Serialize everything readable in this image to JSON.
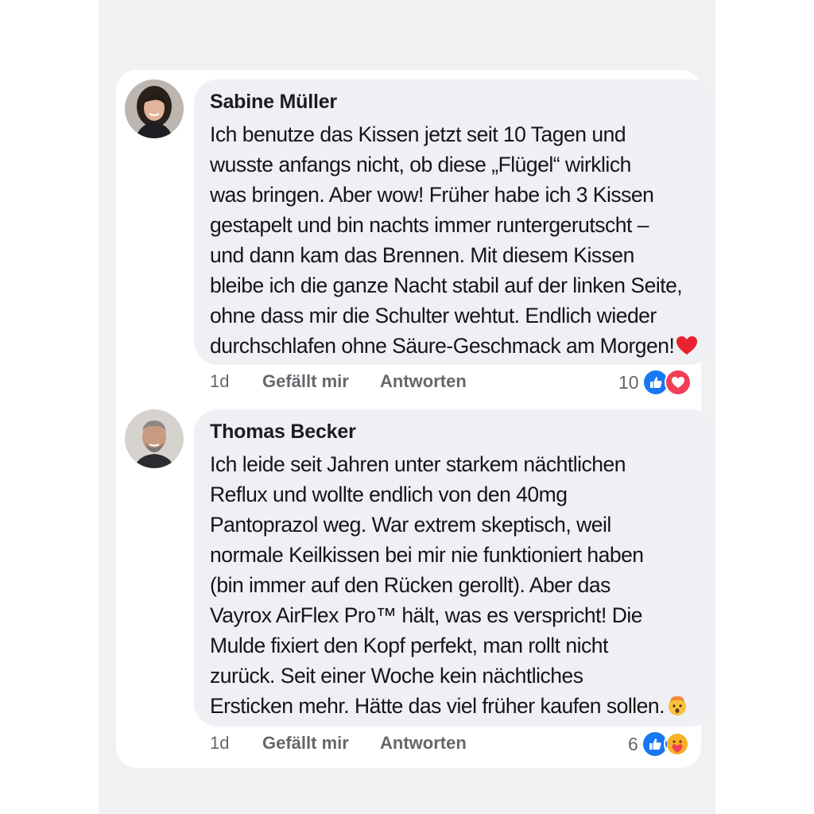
{
  "comments": [
    {
      "author": "Sabine Müller",
      "lines": [
        "Ich benutze das Kissen jetzt seit 10 Tagen und",
        "wusste anfangs nicht, ob diese „Flügel“ wirklich",
        "was bringen. Aber wow! Früher habe ich 3 Kissen",
        "gestapelt und bin nachts immer runtergerutscht –",
        "und dann kam das Brennen. Mit diesem Kissen",
        "bleibe ich die ganze Nacht stabil auf der linken Seite,",
        "ohne dass mir die Schulter wehtut. Endlich wieder",
        "durchschlafen ohne Säure-Geschmack am Morgen!"
      ],
      "trailing_emoji": "red-heart-emoji",
      "time": "1d",
      "like_label": "Gefällt mir",
      "reply_label": "Antworten",
      "reaction_count": "10",
      "reactions": [
        "like-reaction-icon",
        "love-reaction-icon"
      ]
    },
    {
      "author": "Thomas Becker",
      "lines": [
        "Ich leide seit Jahren unter starkem nächtlichen",
        "Reflux und wollte endlich von den 40mg",
        "Pantoprazol weg. War extrem skeptisch, weil",
        "normale Keilkissen bei mir nie funktioniert haben",
        "(bin immer auf den Rücken gerollt). Aber das",
        "Vayrox AirFlex Pro™ hält, was es verspricht! Die",
        "Mulde fixiert den Kopf perfekt, man rollt nicht",
        "zurück. Seit einer Woche kein nächtliches",
        "Ersticken mehr. Hätte das viel früher kaufen sollen."
      ],
      "trailing_emoji": "mind-blown-emoji",
      "time": "1d",
      "like_label": "Gefällt mir",
      "reply_label": "Antworten",
      "reaction_count": "6",
      "reactions": [
        "like-reaction-icon",
        "care-reaction-icon"
      ]
    }
  ],
  "colors": {
    "like_blue": "#1877f2",
    "love_red": "#f33e58",
    "care_yellow": "#f7b125",
    "meta_gray": "#65676b",
    "bubble_bg": "#eef0f3"
  }
}
